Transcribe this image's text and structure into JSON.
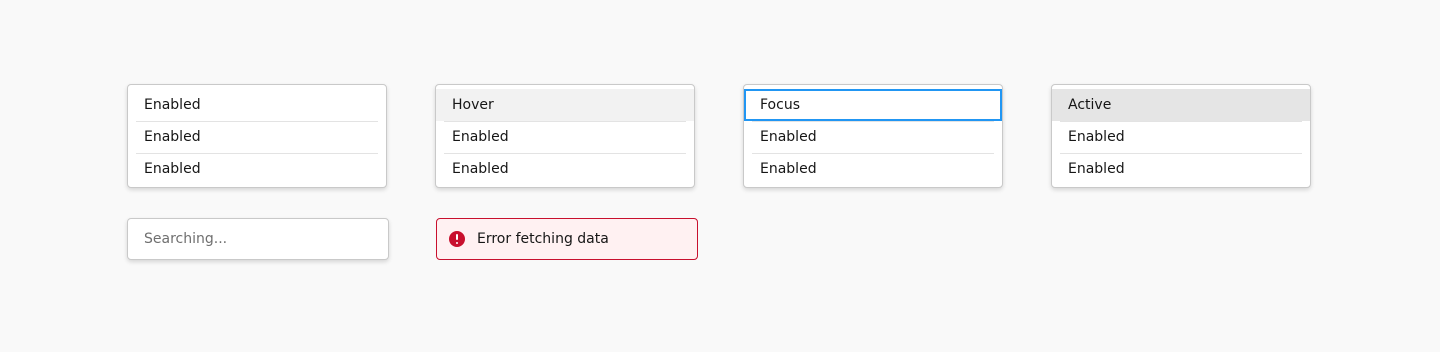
{
  "menus": [
    {
      "items": [
        "Enabled",
        "Enabled",
        "Enabled"
      ]
    },
    {
      "items": [
        "Hover",
        "Enabled",
        "Enabled"
      ]
    },
    {
      "items": [
        "Focus",
        "Enabled",
        "Enabled"
      ]
    },
    {
      "items": [
        "Active",
        "Enabled",
        "Enabled"
      ]
    }
  ],
  "searching": {
    "text": "Searching..."
  },
  "error": {
    "text": "Error fetching data",
    "icon": "error-icon",
    "color": "#c8102e"
  },
  "colors": {
    "focus_border": "#2196f3",
    "hover_bg": "#f2f2f2",
    "active_bg": "#e5e5e5"
  }
}
